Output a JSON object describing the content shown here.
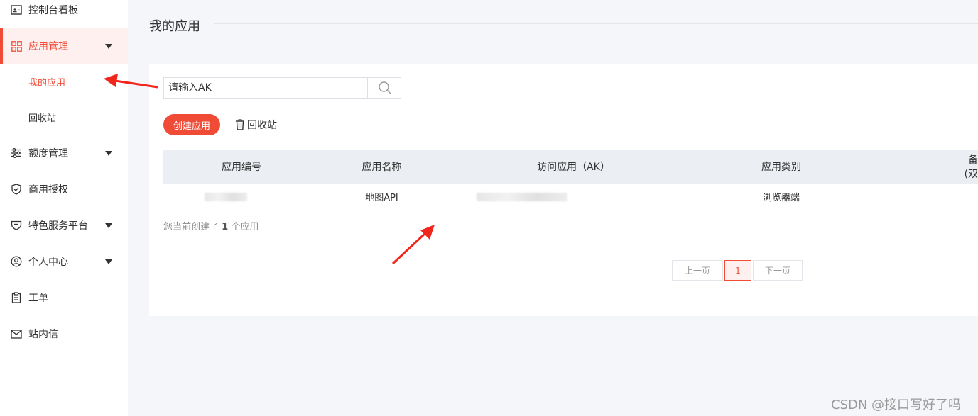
{
  "sidebar": {
    "items": [
      {
        "label": "控制台看板",
        "icon": "dashboard-icon"
      },
      {
        "label": "应用管理",
        "icon": "grid-icon"
      },
      {
        "label": "额度管理",
        "icon": "sliders-icon"
      },
      {
        "label": "商用授权",
        "icon": "shield-check-icon"
      },
      {
        "label": "特色服务平台",
        "icon": "badge-icon"
      },
      {
        "label": "个人中心",
        "icon": "user-icon"
      },
      {
        "label": "工单",
        "icon": "clipboard-icon"
      },
      {
        "label": "站内信",
        "icon": "mail-icon"
      }
    ],
    "sub_items": [
      {
        "label": "我的应用"
      },
      {
        "label": "回收站"
      }
    ]
  },
  "page": {
    "title": "我的应用"
  },
  "search": {
    "placeholder": "请输入AK"
  },
  "toolbar": {
    "create_label": "创建应用",
    "recycle_label": "回收站"
  },
  "table": {
    "headers": [
      "应用编号",
      "应用名称",
      "访问应用（AK）",
      "应用类别",
      "备",
      "(双"
    ],
    "rows": [
      {
        "name": "地图API",
        "category": "浏览器端"
      }
    ]
  },
  "summary": {
    "prefix": "您当前创建了",
    "count": "1",
    "suffix": "个应用"
  },
  "pager": {
    "prev": "上一页",
    "current": "1",
    "next": "下一页"
  },
  "watermark": "CSDN @接口写好了吗",
  "colors": {
    "accent": "#f04b37",
    "sidebar_bg": "#ffffff",
    "page_bg": "#f5f6fa",
    "table_header_bg": "#ebeef3"
  }
}
